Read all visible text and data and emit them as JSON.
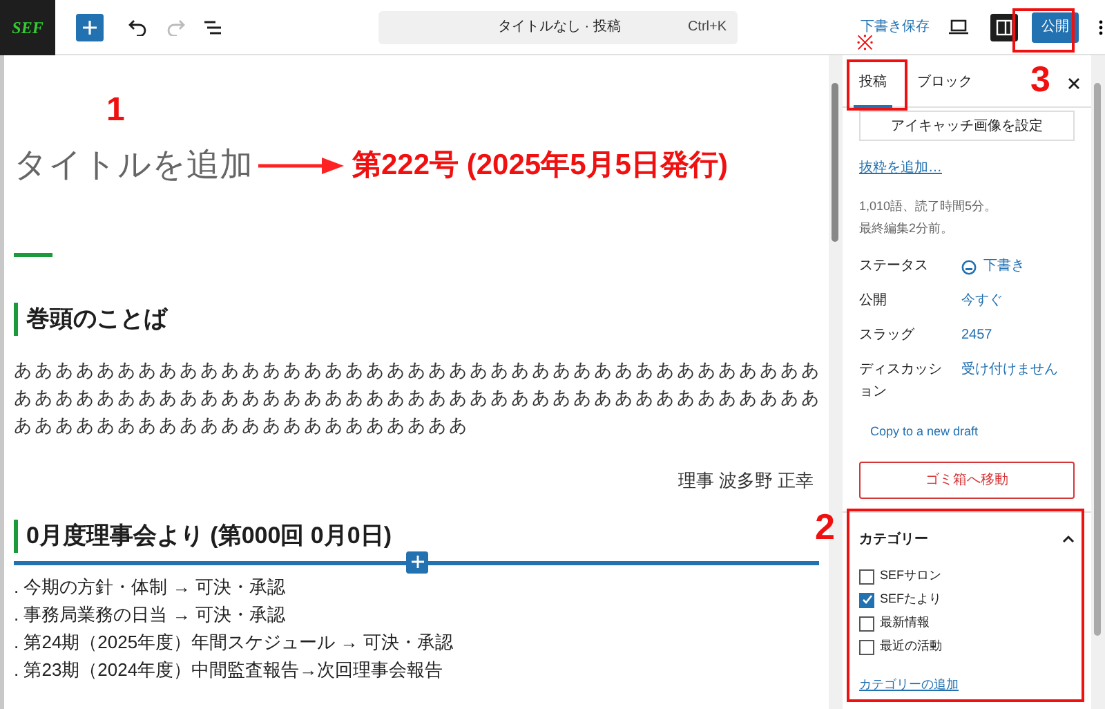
{
  "toolbar": {
    "logo": "SEF",
    "command_bar": {
      "title": "タイトルなし · 投稿",
      "shortcut": "Ctrl+K"
    },
    "save_draft": "下書き保存",
    "publish": "公開"
  },
  "editor": {
    "title_placeholder": "タイトルを追加",
    "title_note": "第222号 (2025年5月5日発行)",
    "sections": [
      {
        "heading": "巻頭のことば",
        "paragraph": "ああああああああああああああああああああああああああああああああああああああああああああああああああああああああああああああああああああああああああああああああああああああああああああああああああああ",
        "signature": "理事 波多野 正幸"
      },
      {
        "heading": "0月度理事会より (第000回 0月0日)",
        "items": [
          ". 今期の方針・体制 → 可決・承認",
          ". 事務局業務の日当 → 可決・承認",
          ". 第24期（2025年度）年間スケジュール → 可決・承認",
          ". 第23期（2024年度）中間監査報告→次回理事会報告"
        ]
      }
    ]
  },
  "sidebar": {
    "tabs": [
      {
        "label": "投稿",
        "selected": true
      },
      {
        "label": "ブロック",
        "selected": false
      }
    ],
    "featured_image": "アイキャッチ画像を設定",
    "excerpt_link": "抜粋を追加…",
    "stats": [
      "1,010語、読了時間5分。",
      "最終編集2分前。"
    ],
    "fields": [
      {
        "label": "ステータス",
        "value": "下書き",
        "kind": "status"
      },
      {
        "label": "公開",
        "value": "今すぐ",
        "kind": "link"
      },
      {
        "label": "スラッグ",
        "value": "2457",
        "kind": "link"
      },
      {
        "label": "ディスカッション",
        "value": "受け付けません",
        "kind": "link"
      }
    ],
    "copy_link": "Copy to a new draft",
    "trash": "ゴミ箱へ移動",
    "categories": {
      "title": "カテゴリー",
      "expanded": true,
      "items": [
        {
          "label": "SEFサロン",
          "checked": false
        },
        {
          "label": "SEFたより",
          "checked": true
        },
        {
          "label": "最新情報",
          "checked": false
        },
        {
          "label": "最近の活動",
          "checked": false
        }
      ],
      "add_link": "カテゴリーの追加"
    }
  },
  "annotations": {
    "numbers": [
      "1",
      "2",
      "3"
    ],
    "mark": "※"
  }
}
